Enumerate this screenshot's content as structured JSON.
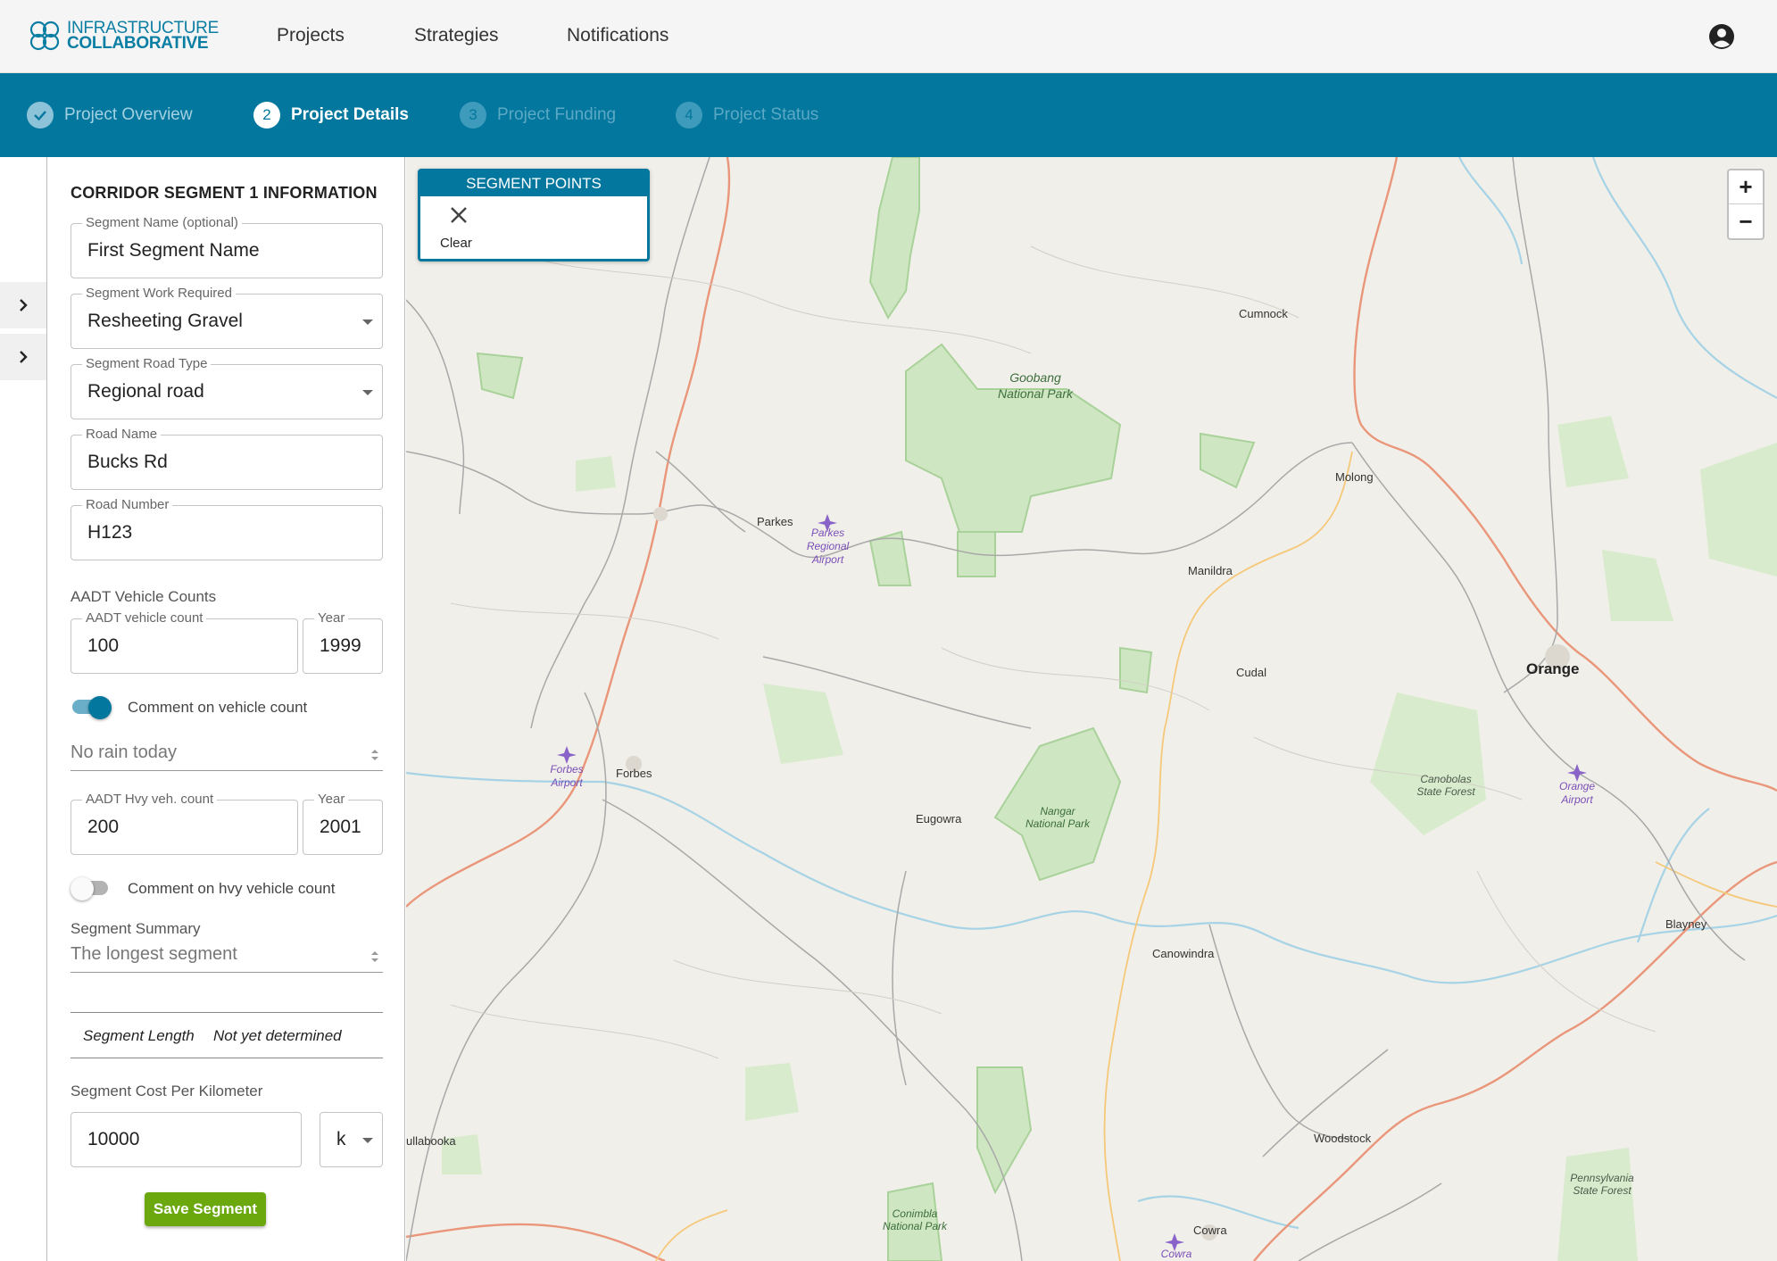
{
  "brand": {
    "line1": "INFRASTRUCTURE",
    "line2": "COLLABORATIVE"
  },
  "nav": {
    "projects": "Projects",
    "strategies": "Strategies",
    "notifications": "Notifications"
  },
  "stepper": {
    "steps": [
      {
        "num": "",
        "label": "Project Overview",
        "state": "done"
      },
      {
        "num": "2",
        "label": "Project Details",
        "state": "active"
      },
      {
        "num": "3",
        "label": "Project Funding",
        "state": "todo"
      },
      {
        "num": "4",
        "label": "Project Status",
        "state": "todo"
      }
    ]
  },
  "form": {
    "title": "CORRIDOR SEGMENT 1 INFORMATION",
    "segment_name": {
      "label": "Segment Name (optional)",
      "value": "First Segment Name"
    },
    "work_required": {
      "label": "Segment Work Required",
      "value": "Resheeting Gravel"
    },
    "road_type": {
      "label": "Segment Road Type",
      "value": "Regional road"
    },
    "road_name": {
      "label": "Road Name",
      "value": "Bucks Rd"
    },
    "road_number": {
      "label": "Road Number",
      "value": "H123"
    },
    "aadt_section": "AADT Vehicle Counts",
    "aadt_count": {
      "label": "AADT vehicle count",
      "value": "100"
    },
    "aadt_year": {
      "label": "Year",
      "value": "1999"
    },
    "comment_vehicle": {
      "label": "Comment on vehicle count",
      "on": true,
      "value": "No rain today"
    },
    "hvy_count": {
      "label": "AADT Hvy veh. count",
      "value": "200"
    },
    "hvy_year": {
      "label": "Year",
      "value": "2001"
    },
    "comment_hvy": {
      "label": "Comment on hvy vehicle count",
      "on": false
    },
    "summary": {
      "label": "Segment Summary",
      "value": "The longest segment"
    },
    "segment_length": {
      "label": "Segment Length",
      "value": "Not yet determined"
    },
    "cost": {
      "label": "Segment Cost Per Kilometer",
      "value": "10000",
      "unit": "k"
    },
    "save": "Save Segment"
  },
  "map": {
    "segment_points": {
      "title": "SEGMENT POINTS",
      "clear": "Clear"
    },
    "zoom_in": "+",
    "zoom_out": "−",
    "places": {
      "cumnock": "Cumnock",
      "parkes": "Parkes",
      "molong": "Molong",
      "manildra": "Manildra",
      "cudal": "Cudal",
      "orange": "Orange",
      "forbes": "Forbes",
      "eugowra": "Eugowra",
      "canowindra": "Canowindra",
      "blayney": "Blayney",
      "woodstock": "Woodstock",
      "cowra": "Cowra",
      "bullabooka": "ullabooka"
    },
    "parks": {
      "goobang": "Goobang National Park",
      "nangar": "Nangar National Park",
      "conimbla": "Conimbla National Park",
      "canobolas": "Canobolas State Forest",
      "pennsylvania": "Pennsylvania State Forest"
    },
    "airports": {
      "parkes": "Parkes Regional Airport",
      "forbes": "Forbes Airport",
      "orange": "Orange Airport",
      "cowra": "Cowra"
    }
  },
  "colors": {
    "brand": "#03779e",
    "save": "#6aa80e",
    "park": "#cfe6c2"
  }
}
